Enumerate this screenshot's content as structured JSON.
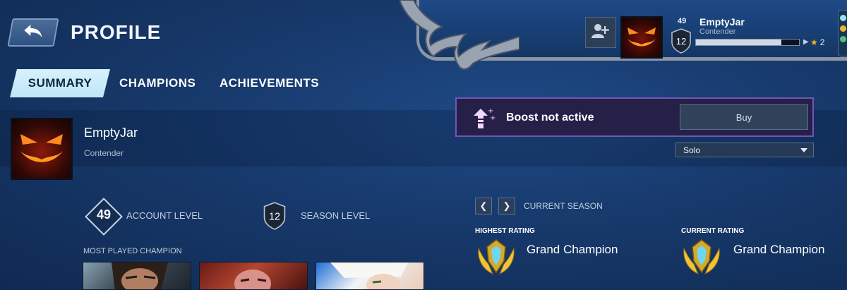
{
  "header": {
    "title": "PROFILE",
    "player": {
      "level": "49",
      "season_level": "12",
      "name": "EmptyJar",
      "rank": "Contender",
      "xp_fraction": 0.83,
      "stars": "2"
    }
  },
  "tabs": [
    "SUMMARY",
    "CHAMPIONS",
    "ACHIEVEMENTS"
  ],
  "active_tab": "SUMMARY",
  "profile": {
    "name": "EmptyJar",
    "rank": "Contender"
  },
  "boost": {
    "status": "Boost not active",
    "buy_label": "Buy"
  },
  "queue_select": {
    "value": "Solo"
  },
  "levels": {
    "account_level": "49",
    "account_label": "ACCOUNT LEVEL",
    "season_level": "12",
    "season_label": "SEASON LEVEL"
  },
  "most_played": {
    "label": "MOST PLAYED CHAMPION"
  },
  "season": {
    "title": "CURRENT SEASON",
    "highest_label": "HIGHEST RATING",
    "highest_value": "Grand Champion",
    "current_label": "CURRENT RATING",
    "current_value": "Grand Champion"
  },
  "colors": {
    "background": "#17396b",
    "boost_border": "#7156b3",
    "tab_active": "#cfecf9",
    "star": "#f3b91e",
    "emblem_gold": "#f0c33a"
  }
}
